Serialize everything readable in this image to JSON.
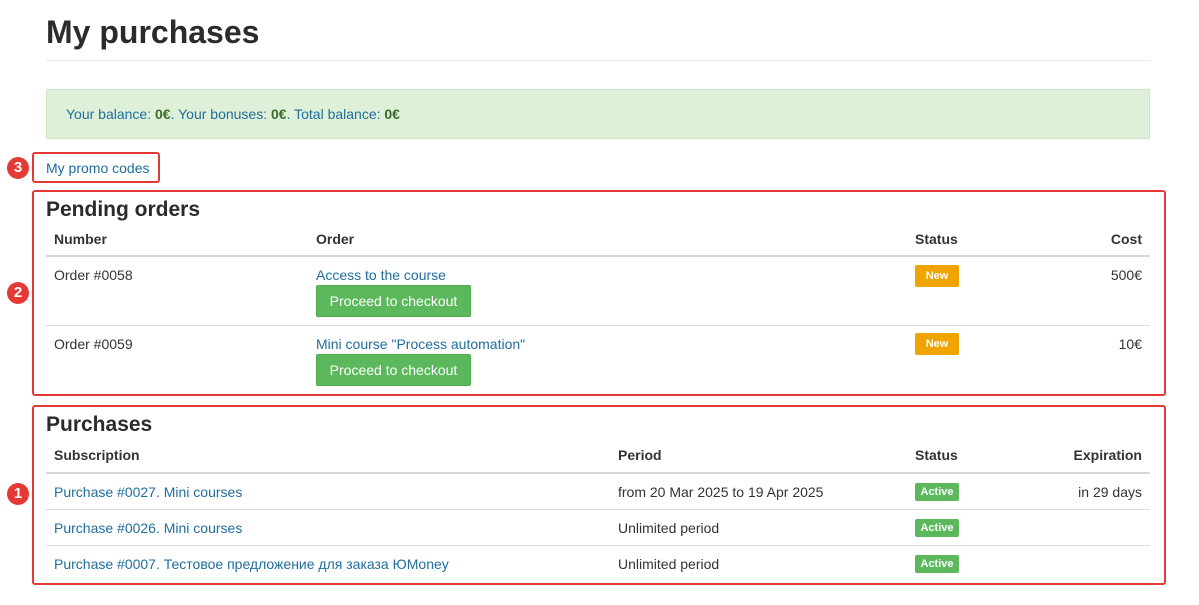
{
  "page": {
    "title": "My purchases"
  },
  "balance": {
    "balance_label": "Your balance: ",
    "balance_value": "0€",
    "bonuses_label": ". Your bonuses: ",
    "bonuses_value": "0€",
    "total_label": ". Total balance: ",
    "total_value": "0€"
  },
  "promo_link": "My promo codes",
  "annotations": {
    "marker_1": "1",
    "marker_2": "2",
    "marker_3": "3"
  },
  "pending": {
    "title": "Pending orders",
    "columns": {
      "number": "Number",
      "order": "Order",
      "status": "Status",
      "cost": "Cost"
    },
    "rows": [
      {
        "number": "Order #0058",
        "order": "Access to the course",
        "button": "Proceed to checkout",
        "status": "New",
        "cost": "500€"
      },
      {
        "number": "Order #0059",
        "order": "Mini course \"Process automation\"",
        "button": "Proceed to checkout",
        "status": "New",
        "cost": "10€"
      }
    ]
  },
  "purchases": {
    "title": "Purchases",
    "columns": {
      "subscription": "Subscription",
      "period": "Period",
      "status": "Status",
      "expiration": "Expiration"
    },
    "rows": [
      {
        "subscription": "Purchase #0027. Mini courses",
        "period": "from 20 Mar 2025 to 19 Apr 2025",
        "status": "Active",
        "expiration": "in 29 days"
      },
      {
        "subscription": "Purchase #0026. Mini courses",
        "period": "Unlimited period",
        "status": "Active",
        "expiration": ""
      },
      {
        "subscription": "Purchase #0007. Тестовое предложение для заказа ЮMoney",
        "period": "Unlimited period",
        "status": "Active",
        "expiration": ""
      }
    ]
  },
  "colors": {
    "link": "#1f6e9c",
    "success": "#5cb85c",
    "new_badge": "#f0a400",
    "annotation": "#e53935",
    "alert_bg": "#dff0d8"
  }
}
